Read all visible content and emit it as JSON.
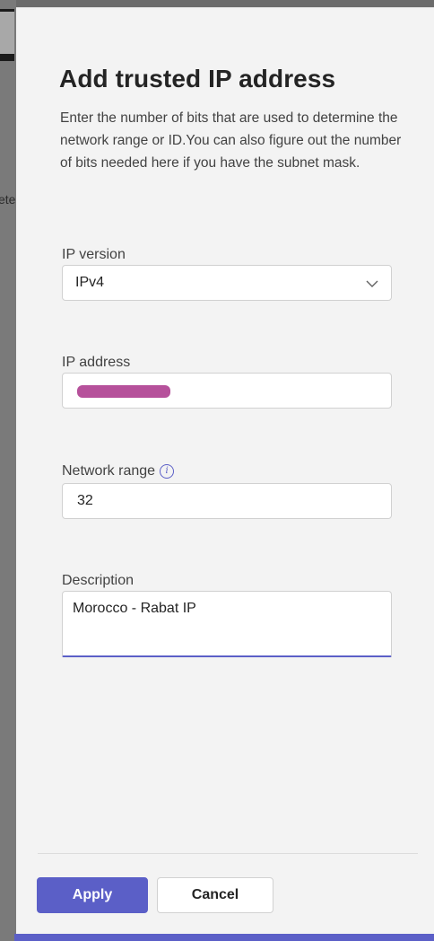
{
  "background": {
    "text_fragment": "ete"
  },
  "panel": {
    "title": "Add trusted IP address",
    "description": "Enter the number of bits that are used to determine the network range or ID.You can also figure out the number of bits needed here if you have the subnet mask.",
    "ip_version": {
      "label": "IP version",
      "value": "IPv4",
      "icon": "chevron-down-icon"
    },
    "ip_address": {
      "label": "IP address",
      "value_redacted": true
    },
    "network_range": {
      "label": "Network range",
      "value": "32",
      "icon": "info-icon"
    },
    "description_field": {
      "label": "Description",
      "value": "Morocco - Rabat IP"
    },
    "buttons": {
      "apply_label": "Apply",
      "cancel_label": "Cancel"
    }
  },
  "colors": {
    "accent": "#5b5fc7",
    "panel_background": "#f3f3f3",
    "redaction": "#a9338a"
  }
}
